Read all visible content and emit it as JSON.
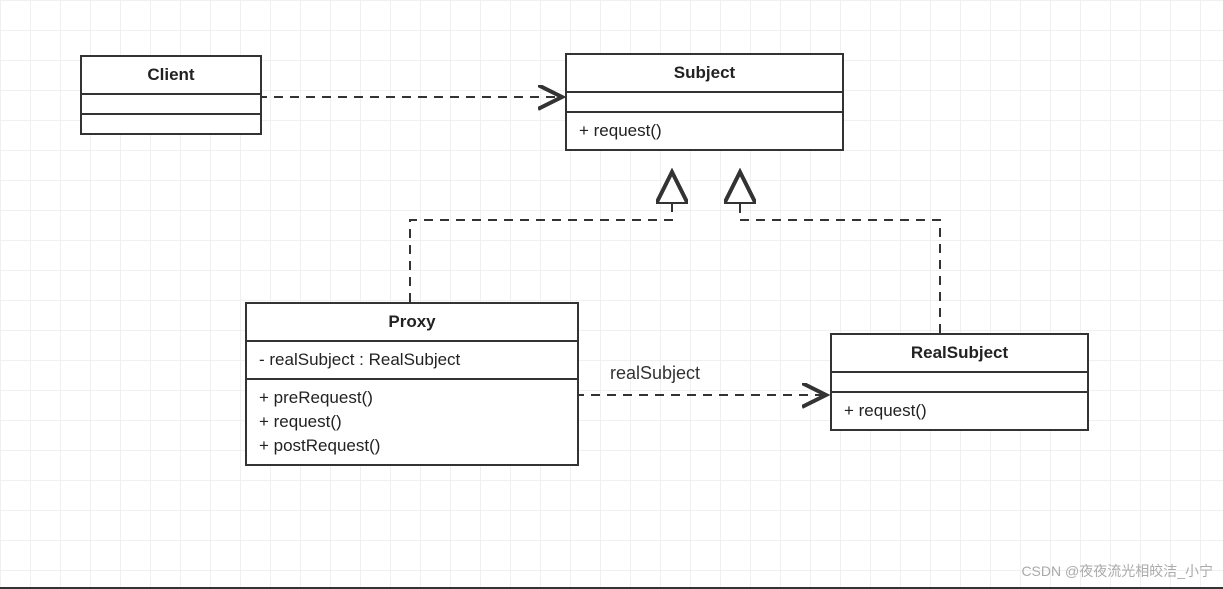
{
  "diagram": {
    "client": {
      "title": "Client"
    },
    "subject": {
      "title": "Subject",
      "ops": {
        "request": "+ request()"
      }
    },
    "proxy": {
      "title": "Proxy",
      "attrs": {
        "realSubject": "- realSubject : RealSubject"
      },
      "ops": {
        "preRequest": "+ preRequest()",
        "request": "+ request()",
        "postRequest": "+ postRequest()"
      }
    },
    "realSubject": {
      "title": "RealSubject",
      "ops": {
        "request": "+ request()"
      }
    },
    "assocLabel": "realSubject",
    "watermark": "CSDN @夜夜流光相皎洁_小宁"
  }
}
